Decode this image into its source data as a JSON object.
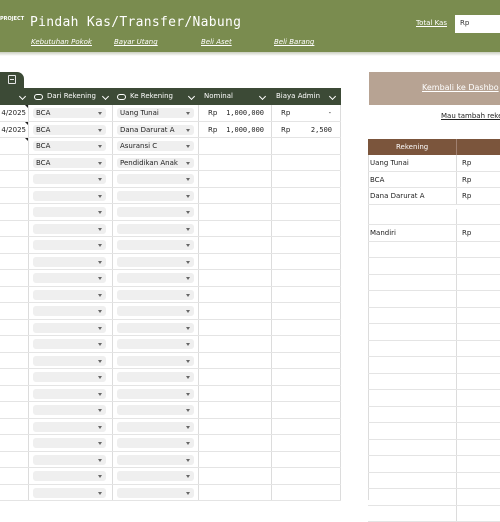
{
  "header": {
    "logo_text": "PROJECT",
    "title": "Pindah Kas/Transfer/Nabung",
    "nav": [
      {
        "label": "Kebutuhan Pokok"
      },
      {
        "label": "Bayar Utang"
      },
      {
        "label": "Beli Aset"
      },
      {
        "label": "Beli Barang"
      }
    ],
    "total_label": "Total Kas",
    "total_currency": "Rp"
  },
  "table": {
    "columns": {
      "dari": "Dari Rekening",
      "ke": "Ke Rekening",
      "nominal": "Nominal",
      "biaya": "Biaya Admin"
    },
    "rows": [
      {
        "date": "4/2025",
        "dari": "BCA",
        "ke": "Uang Tunai",
        "nominal_cur": "Rp",
        "nominal": "1,000,000",
        "biaya_cur": "Rp",
        "biaya": "-"
      },
      {
        "date": "4/2025",
        "dari": "BCA",
        "ke": "Dana Darurat A",
        "nominal_cur": "Rp",
        "nominal": "1,000,000",
        "biaya_cur": "Rp",
        "biaya": "2,500"
      },
      {
        "date": "",
        "dari": "BCA",
        "ke": "Asuransi C",
        "nominal_cur": "",
        "nominal": "",
        "biaya_cur": "",
        "biaya": ""
      },
      {
        "date": "",
        "dari": "BCA",
        "ke": "Pendidikan Anak",
        "nominal_cur": "",
        "nominal": "",
        "biaya_cur": "",
        "biaya": ""
      }
    ],
    "empty_row_count": 20
  },
  "right_panel": {
    "back_button": "Kembali ke Dashbo",
    "add_link": "Mau tambah reken",
    "header": "Rekening",
    "accounts": [
      {
        "name": "Uang Tunai",
        "currency": "Rp"
      },
      {
        "name": "BCA",
        "currency": "Rp"
      },
      {
        "name": "Dana Darurat A",
        "currency": "Rp"
      },
      {
        "name": "",
        "currency": ""
      },
      {
        "name": "Mandiri",
        "currency": "Rp"
      }
    ],
    "empty_rows": 17
  },
  "colors": {
    "header_bg": "#7a8c4f",
    "table_header_bg": "#3c4a36",
    "back_button_bg": "#b7a393",
    "right_table_header_bg": "#7b553c"
  }
}
